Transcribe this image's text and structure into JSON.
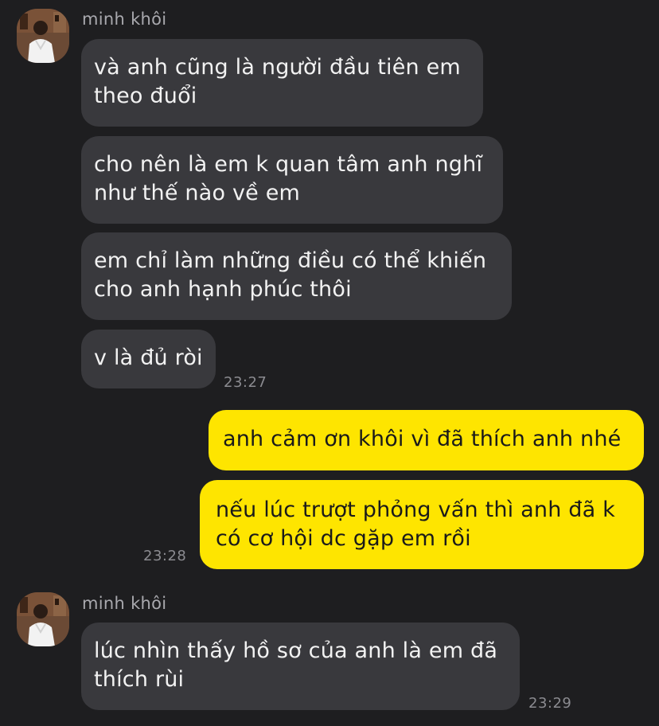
{
  "groups": [
    {
      "sender": "minh khôi",
      "avatar_icon": "profile-photo-avatar-icon",
      "messages": [
        "và anh cũng là người đầu tiên em\ntheo đuổi",
        "cho nên là em k quan tâm anh nghĩ\nnhư thế nào về em",
        "em chỉ làm những điều có thể khiến\ncho anh hạnh phúc thôi",
        "v là đủ ròi"
      ],
      "time": "23:27"
    },
    {
      "sender": "me",
      "messages": [
        "anh cảm ơn khôi vì đã thích anh nhé",
        "nếu lúc trượt phỏng vấn thì anh đã k\ncó cơ hội dc gặp em rồi"
      ],
      "time": "23:28"
    },
    {
      "sender": "minh khôi",
      "avatar_icon": "profile-photo-avatar-icon",
      "messages": [
        "lúc nhìn thấy hồ sơ của anh là em đã\nthích rùi"
      ],
      "time": "23:29"
    }
  ],
  "colors": {
    "background": "#1e1e20",
    "incoming_bubble": "#39393d",
    "outgoing_bubble": "#fee500",
    "sender_name": "#a9a9ae",
    "timestamp": "#8b8b90"
  }
}
